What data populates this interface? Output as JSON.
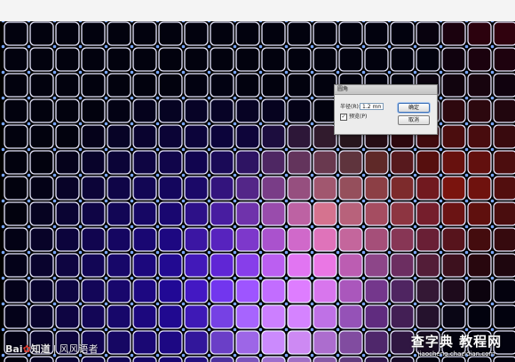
{
  "dialog": {
    "title": "圆角",
    "radius_label": "半径(R):",
    "radius_value": "1.2 mm",
    "preview_label": "预览(P)",
    "preview_checked": true,
    "checkbox_mark": "✓",
    "ok_label": "确定",
    "cancel_label": "取消"
  },
  "watermark_left": {
    "brand": "Bai",
    "paw": "✿",
    "brand_tail": "知道",
    "separator": "|",
    "author": "风风语者"
  },
  "watermark_right": {
    "site_name": "查字典 教程网",
    "site_url": "jiaocheng.chazidian.com"
  },
  "colors": {
    "grid_line": "#e8e8ff",
    "anchor": "#7aa7ff",
    "accent_blue": "#2f5fff",
    "accent_pink": "#e070c0",
    "accent_orange": "#d09060"
  }
}
